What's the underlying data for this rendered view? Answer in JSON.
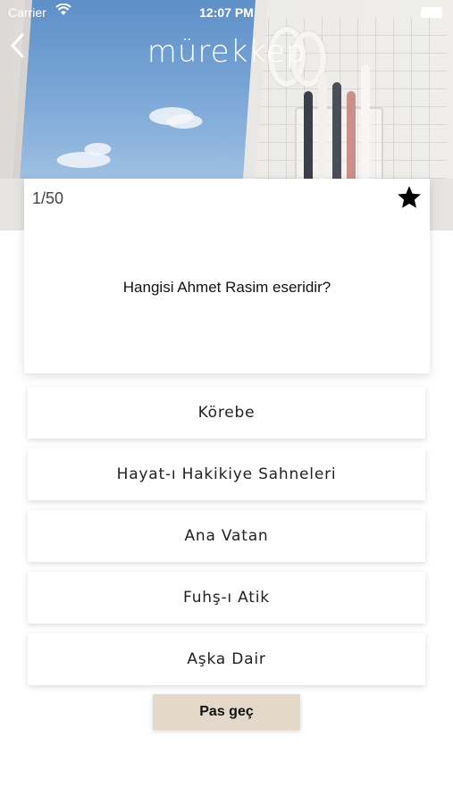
{
  "status_bar": {
    "carrier": "Carrier",
    "time": "12:07 PM"
  },
  "header": {
    "title": "mürekkep",
    "back_icon": "chevron-left-icon"
  },
  "question_card": {
    "counter": "1/50",
    "favorite_icon": "star-icon",
    "question": "Hangisi Ahmet Rasim eseridir?"
  },
  "answers": [
    {
      "label": "Körebe"
    },
    {
      "label": "Hayat-ı Hakikiye Sahneleri"
    },
    {
      "label": "Ana Vatan"
    },
    {
      "label": "Fuhş-ı Atik"
    },
    {
      "label": "Aşka Dair"
    }
  ],
  "pass_button": {
    "label": "Pas geç"
  },
  "colors": {
    "pass_button_bg": "#e4d8cb",
    "card_bg": "#ffffff"
  }
}
